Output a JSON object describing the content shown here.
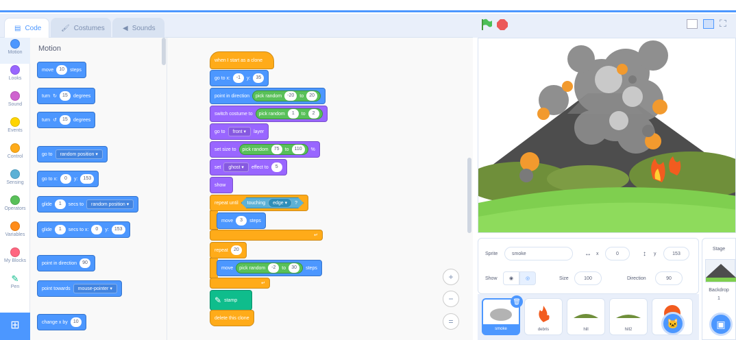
{
  "tabs": {
    "code": "Code",
    "costumes": "Costumes",
    "sounds": "Sounds"
  },
  "categories": [
    {
      "label": "Motion",
      "color": "#4c97ff"
    },
    {
      "label": "Looks",
      "color": "#9966ff"
    },
    {
      "label": "Sound",
      "color": "#cf63cf"
    },
    {
      "label": "Events",
      "color": "#ffd500"
    },
    {
      "label": "Control",
      "color": "#ffab19"
    },
    {
      "label": "Sensing",
      "color": "#5cb1d6"
    },
    {
      "label": "Operators",
      "color": "#59c059"
    },
    {
      "label": "Variables",
      "color": "#ff8c1a"
    },
    {
      "label": "My Blocks",
      "color": "#ff6680"
    },
    {
      "label": "Pen",
      "color": "#0fbd8c"
    }
  ],
  "palette": {
    "title": "Motion",
    "move": {
      "a": "move",
      "n": "10",
      "b": "steps"
    },
    "turn_right": {
      "a": "turn",
      "n": "15",
      "b": "degrees"
    },
    "turn_left": {
      "a": "turn",
      "n": "15",
      "b": "degrees"
    },
    "goto": {
      "a": "go to",
      "d": "random position"
    },
    "gotoxy": {
      "a": "go to x:",
      "x": "0",
      "y_label": "y:",
      "y": "153"
    },
    "glide_to": {
      "a": "glide",
      "n": "1",
      "b": "secs to",
      "d": "random position"
    },
    "glide_xy": {
      "a": "glide",
      "n": "1",
      "b": "secs to x:",
      "x": "0",
      "y_label": "y:",
      "y": "153"
    },
    "point_dir": {
      "a": "point in direction",
      "n": "90"
    },
    "point_towards": {
      "a": "point towards",
      "d": "mouse-pointer"
    },
    "change_x": {
      "a": "change x by",
      "n": "10"
    }
  },
  "script": {
    "hat": "when I start as a clone",
    "goto": {
      "a": "go to x:",
      "x": "-1",
      "y_label": "y:",
      "y": "35"
    },
    "point": {
      "a": "point in direction",
      "op": "pick random",
      "from": "-20",
      "to_label": "to",
      "to": "20"
    },
    "costume": {
      "a": "switch costume to",
      "op": "pick random",
      "from": "1",
      "to_label": "to",
      "to": "2"
    },
    "layer": {
      "a": "go to",
      "d": "front",
      "b": "layer"
    },
    "size": {
      "a": "set size to",
      "op": "pick random",
      "from": "75",
      "to_label": "to",
      "to": "110",
      "pct": "%"
    },
    "effect": {
      "a": "set",
      "d": "ghost",
      "b": "effect to",
      "n": "5"
    },
    "show": "show",
    "repeat_until": {
      "a": "repeat until",
      "s": "touching",
      "d": "edge",
      "q": "?"
    },
    "move1": {
      "a": "move",
      "n": "3",
      "b": "steps"
    },
    "repeat": {
      "a": "repeat",
      "n": "20"
    },
    "move2": {
      "a": "move",
      "op": "pick random",
      "from": "-2",
      "to_label": "to",
      "to": "30",
      "b": "steps"
    },
    "stamp": "stamp",
    "delete": "delete this clone"
  },
  "zoom": {
    "in": "+",
    "out": "−",
    "reset": "="
  },
  "sprite_info": {
    "sprite_label": "Sprite",
    "sprite_name": "smoke",
    "x_label": "x",
    "x": "0",
    "y_label": "y",
    "y": "153",
    "show_label": "Show",
    "size_label": "Size",
    "size": "100",
    "direction_label": "Direction",
    "direction": "90"
  },
  "sprites": [
    "smoke",
    "debris",
    "hill",
    "hill2"
  ],
  "stage_panel": {
    "title": "Stage",
    "backdrops_label": "Backdrop",
    "backdrops_count": "1"
  },
  "colors": {
    "accent": "#4c97ff",
    "flag": "#4cbf56",
    "stop": "#ec5959"
  }
}
